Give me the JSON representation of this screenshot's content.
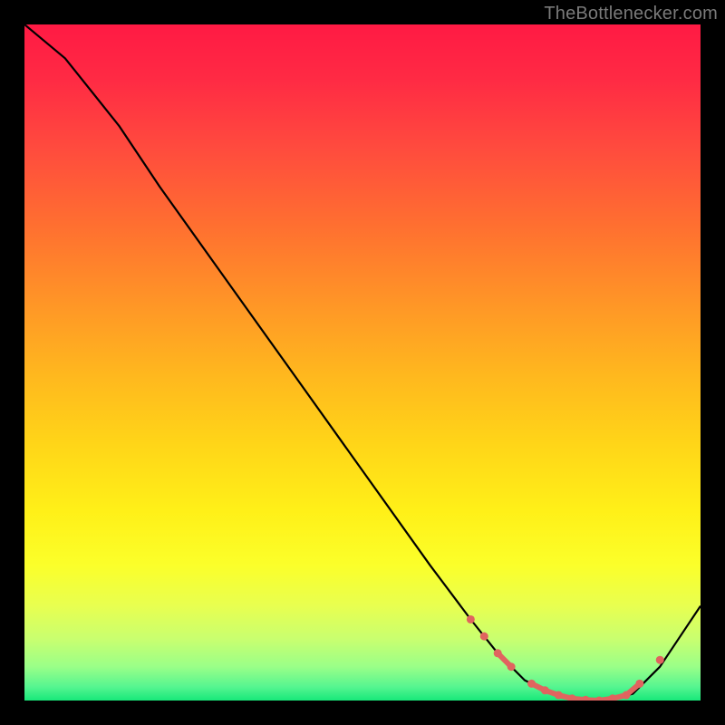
{
  "attribution": "TheBottlenecker.com",
  "colors": {
    "background": "#000000",
    "curve": "#000000",
    "marker": "#e0645f",
    "gradient_top": "#ff1a44",
    "gradient_bottom": "#18e87a"
  },
  "chart_data": {
    "type": "line",
    "title": "",
    "xlabel": "",
    "ylabel": "",
    "xlim": [
      0,
      100
    ],
    "ylim": [
      0,
      100
    ],
    "series": [
      {
        "name": "curve",
        "x": [
          0,
          6,
          10,
          14,
          20,
          30,
          40,
          50,
          60,
          66,
          70,
          74,
          78,
          82,
          86,
          90,
          94,
          100
        ],
        "y": [
          100,
          95,
          90,
          85,
          76,
          62,
          48,
          34,
          20,
          12,
          7,
          3,
          1,
          0,
          0,
          1,
          5,
          14
        ]
      }
    ],
    "markers": {
      "name": "highlight-dots",
      "x": [
        66,
        68,
        70,
        72,
        75,
        77,
        79,
        81,
        83,
        85,
        87,
        89,
        91,
        94
      ],
      "y": [
        12,
        9.5,
        7,
        5,
        2.5,
        1.5,
        0.8,
        0.3,
        0.1,
        0,
        0.3,
        0.8,
        2.5,
        6
      ]
    }
  }
}
